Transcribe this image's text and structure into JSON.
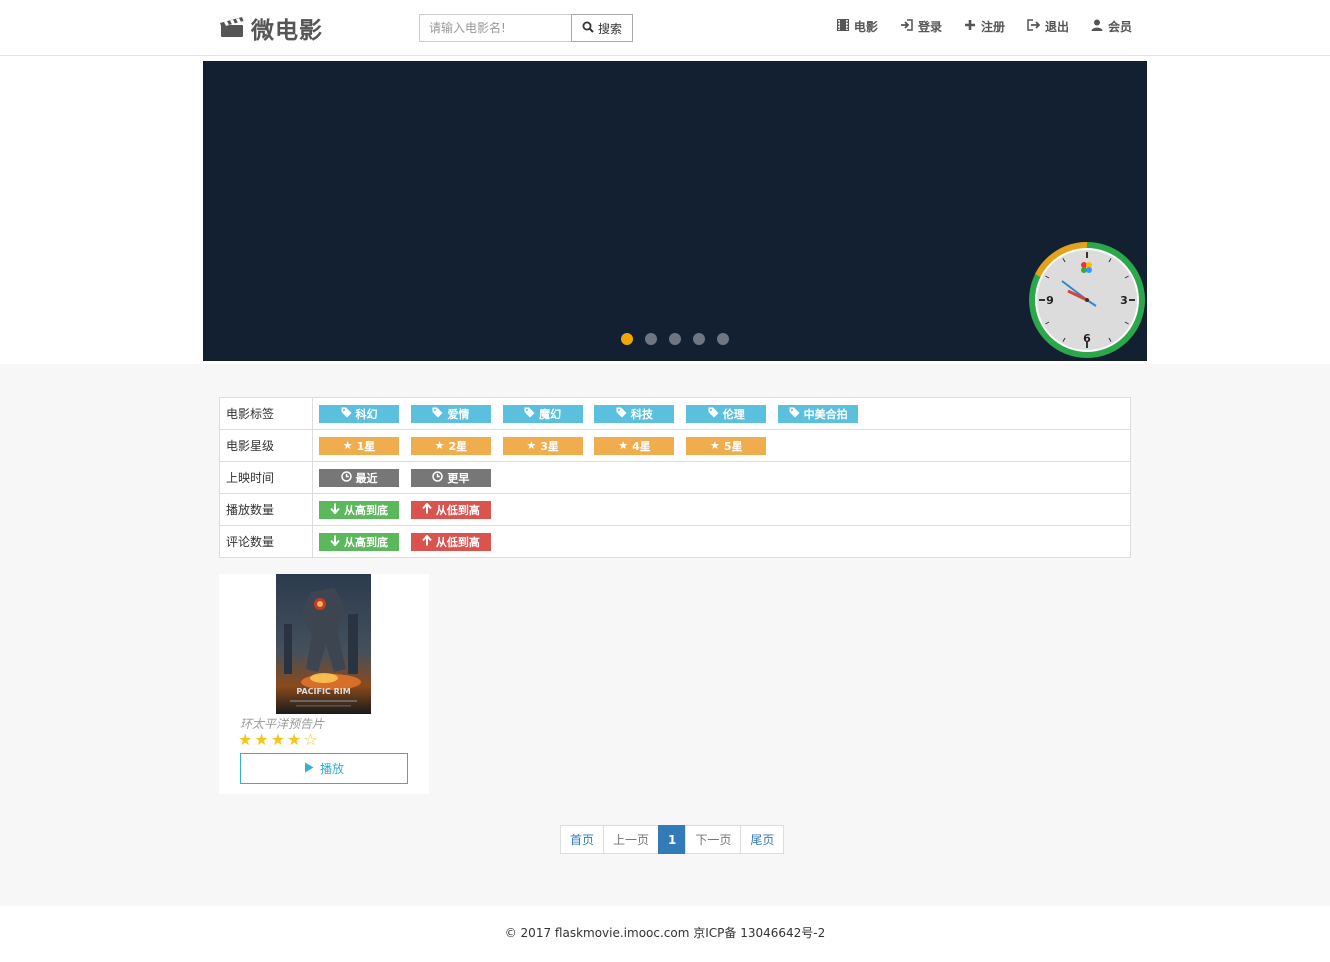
{
  "brand": {
    "name": "微电影",
    "icon": "clapperboard-icon"
  },
  "search": {
    "placeholder": "请输入电影名!",
    "value": "",
    "button_label": "搜索"
  },
  "nav": {
    "items": [
      {
        "label": "电影",
        "icon": "film-icon"
      },
      {
        "label": "登录",
        "icon": "login-icon"
      },
      {
        "label": "注册",
        "icon": "plus-icon"
      },
      {
        "label": "退出",
        "icon": "logout-icon"
      },
      {
        "label": "会员",
        "icon": "user-icon"
      }
    ]
  },
  "carousel": {
    "slide_count": 5,
    "active_index": 0,
    "bg_color": "#132032",
    "active_dot_color": "#f0a70a"
  },
  "clock": {
    "numerals": [
      "3",
      "6",
      "9"
    ],
    "hour_hand_time": "10:10",
    "minute_hand": 50,
    "ring_colors": [
      "#2aa84a",
      "#e3a21a"
    ]
  },
  "filters": [
    {
      "label": "电影标签",
      "style": "info",
      "icon": "tag-icon",
      "options": [
        "科幻",
        "爱情",
        "魔幻",
        "科技",
        "伦理",
        "中美合拍"
      ]
    },
    {
      "label": "电影星级",
      "style": "warning",
      "icon": "star-icon",
      "options": [
        "1星",
        "2星",
        "3星",
        "4星",
        "5星"
      ]
    },
    {
      "label": "上映时间",
      "style": "gray",
      "icon": "clock-icon",
      "options": [
        "最近",
        "更早"
      ]
    },
    {
      "label": "播放数量",
      "style": "mixed",
      "options": [
        {
          "text": "从高到底",
          "style": "success",
          "icon": "arrow-down-icon"
        },
        {
          "text": "从低到高",
          "style": "danger",
          "icon": "arrow-up-icon"
        }
      ]
    },
    {
      "label": "评论数量",
      "style": "mixed",
      "options": [
        {
          "text": "从高到底",
          "style": "success",
          "icon": "arrow-down-icon"
        },
        {
          "text": "从低到高",
          "style": "danger",
          "icon": "arrow-up-icon"
        }
      ]
    }
  ],
  "movie": {
    "title": "环太平洋预告片",
    "poster_text": "PACIFIC RIM",
    "rating": 4,
    "rating_max": 5,
    "play_label": "播放"
  },
  "pagination": {
    "first": "首页",
    "prev": "上一页",
    "current": "1",
    "next": "下一页",
    "last": "尾页"
  },
  "footer": {
    "text": "© 2017 flaskmovie.imooc.com 京ICP备 13046642号-2"
  }
}
